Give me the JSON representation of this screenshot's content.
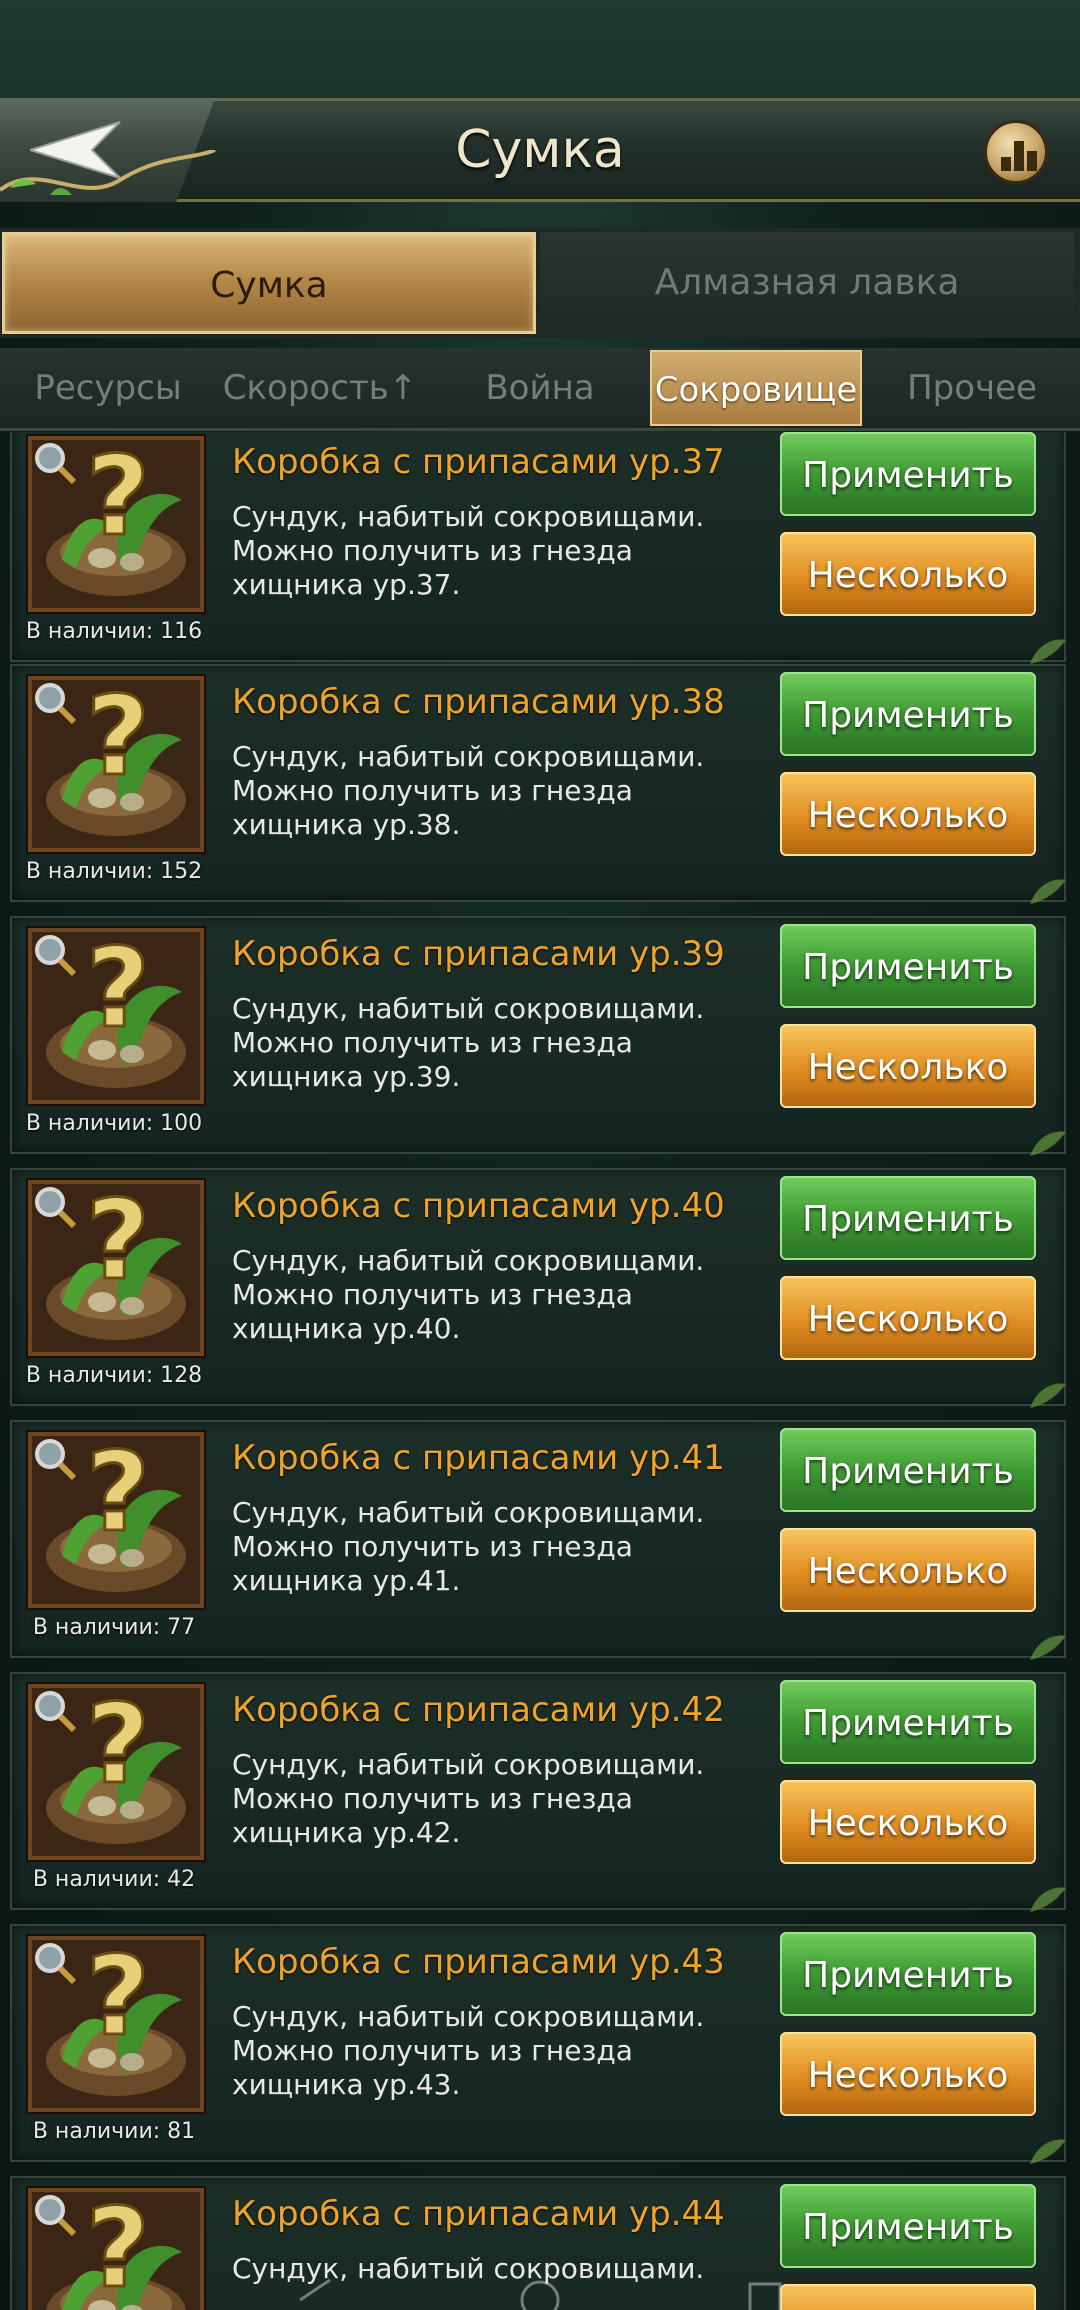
{
  "header": {
    "title": "Сумка"
  },
  "main_tabs": [
    {
      "label": "Сумка",
      "active": true
    },
    {
      "label": "Алмазная лавка",
      "active": false
    }
  ],
  "sub_tabs": [
    {
      "label": "Ресурсы",
      "active": false
    },
    {
      "label": "Скорость↑",
      "active": false
    },
    {
      "label": "Война",
      "active": false
    },
    {
      "label": "Сокровище",
      "active": true
    },
    {
      "label": "Прочее",
      "active": false
    }
  ],
  "buttons": {
    "apply_label": "Применить",
    "multi_label": "Несколько"
  },
  "items": [
    {
      "title": "Коробка с припасами ур.37",
      "desc1": "Сундук, набитый сокровищами.",
      "desc2": "Можно получить из гнезда",
      "desc3": "хищника ур.37.",
      "stock": "В наличии: 116"
    },
    {
      "title": "Коробка с припасами ур.38",
      "desc1": "Сундук, набитый сокровищами.",
      "desc2": "Можно получить из гнезда",
      "desc3": "хищника ур.38.",
      "stock": "В наличии: 152"
    },
    {
      "title": "Коробка с припасами ур.39",
      "desc1": "Сундук, набитый сокровищами.",
      "desc2": "Можно получить из гнезда",
      "desc3": "хищника ур.39.",
      "stock": "В наличии: 100"
    },
    {
      "title": "Коробка с припасами ур.40",
      "desc1": "Сундук, набитый сокровищами.",
      "desc2": "Можно получить из гнезда",
      "desc3": "хищника ур.40.",
      "stock": "В наличии: 128"
    },
    {
      "title": "Коробка с припасами ур.41",
      "desc1": "Сундук, набитый сокровищами.",
      "desc2": "Можно получить из гнезда",
      "desc3": "хищника ур.41.",
      "stock": "В наличии: 77"
    },
    {
      "title": "Коробка с припасами ур.42",
      "desc1": "Сундук, набитый сокровищами.",
      "desc2": "Можно получить из гнезда",
      "desc3": "хищника ур.42.",
      "stock": "В наличии: 42"
    },
    {
      "title": "Коробка с припасами ур.43",
      "desc1": "Сундук, набитый сокровищами.",
      "desc2": "Можно получить из гнезда",
      "desc3": "хищника ур.43.",
      "stock": "В наличии: 81"
    },
    {
      "title": "Коробка с припасами ур.44",
      "desc1": "Сундук, набитый сокровищами.",
      "desc2": "",
      "desc3": "",
      "stock": ""
    }
  ]
}
